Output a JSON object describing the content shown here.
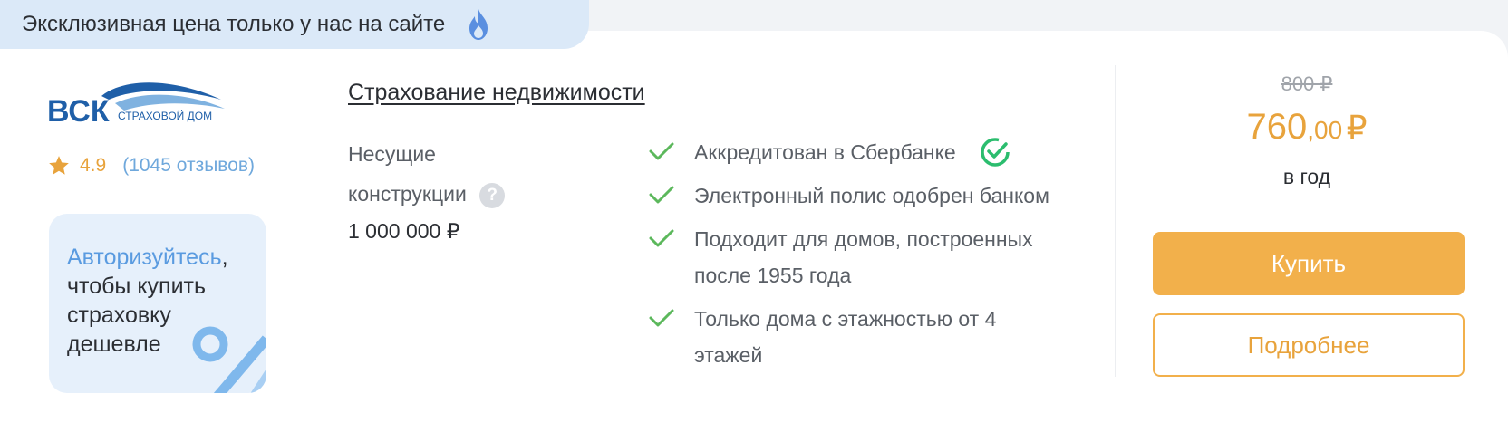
{
  "banner": {
    "text": "Эксклюзивная цена только у нас на сайте",
    "icon": "flame-icon"
  },
  "insurer": {
    "logo_text": "ВСК",
    "logo_subtext": "СТРАХОВОЙ ДОМ",
    "rating": "4.9",
    "reviews": "(1045 отзывов)"
  },
  "promo": {
    "link_text": "Авторизуйтесь",
    "comma": ",",
    "rest_text": "чтобы купить страховку дешевле"
  },
  "product": {
    "title": "Страхование недвижимости",
    "coverage_label": "Несущие конструкции",
    "coverage_help": "?",
    "coverage_value": "1 000 000 ₽"
  },
  "features": [
    "Аккредитован в Сбербанке",
    "Электронный полис одобрен банком",
    "Подходит для домов, построенных после 1955 года",
    "Только дома с этажностью от 4 этажей"
  ],
  "pricing": {
    "old_price": "800 ₽",
    "price_main": "760",
    "price_cents": ",00",
    "price_currency": "₽",
    "period": "в год"
  },
  "actions": {
    "buy_label": "Купить",
    "details_label": "Подробнее"
  },
  "colors": {
    "accent": "#f2b04b",
    "link": "#5a9be0",
    "check": "#5cb85c",
    "logo": "#1f5fa8"
  }
}
